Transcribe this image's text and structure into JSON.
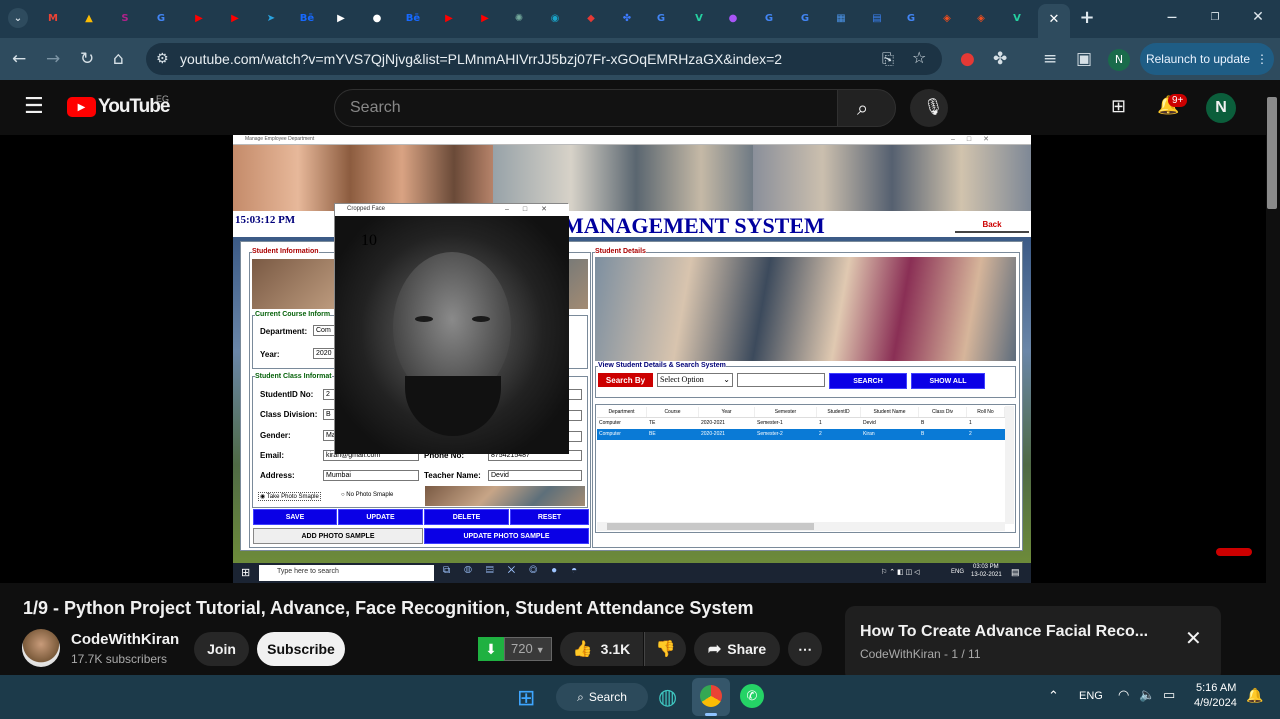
{
  "browser": {
    "tabs": [
      {
        "icon": "gmail-icon",
        "glyph": "M",
        "color": "#ea4335"
      },
      {
        "icon": "drive-icon",
        "glyph": "▲",
        "color": "#fbbc04"
      },
      {
        "icon": "s-icon",
        "glyph": "S",
        "color": "#b0218a"
      },
      {
        "icon": "google-icon",
        "glyph": "G",
        "color": "#4285f4"
      },
      {
        "icon": "youtube-icon",
        "glyph": "▶",
        "color": "#ff0000"
      },
      {
        "icon": "youtube-icon",
        "glyph": "▶",
        "color": "#ff0000"
      },
      {
        "icon": "telegram-icon",
        "glyph": "➤",
        "color": "#2aa3e0"
      },
      {
        "icon": "behance-icon",
        "glyph": "Bē",
        "color": "#1769ff"
      },
      {
        "icon": "doc-icon",
        "glyph": "▶",
        "color": "#ffffff"
      },
      {
        "icon": "github-icon",
        "glyph": "●",
        "color": "#ffffff"
      },
      {
        "icon": "behance-icon",
        "glyph": "Bē",
        "color": "#1769ff"
      },
      {
        "icon": "youtube-icon",
        "glyph": "▶",
        "color": "#ff0000"
      },
      {
        "icon": "youtube-icon",
        "glyph": "▶",
        "color": "#ff0000"
      },
      {
        "icon": "chatgpt-icon",
        "glyph": "✺",
        "color": "#74aa9c"
      },
      {
        "icon": "lens-icon",
        "glyph": "◉",
        "color": "#1aa3c8"
      },
      {
        "icon": "app-icon",
        "glyph": "◆",
        "color": "#e53935"
      },
      {
        "icon": "puzzle-icon",
        "glyph": "✤",
        "color": "#3d7bff"
      },
      {
        "icon": "google-icon",
        "glyph": "G",
        "color": "#4285f4"
      },
      {
        "icon": "v-icon",
        "glyph": "V",
        "color": "#25d0a0"
      },
      {
        "icon": "drop-icon",
        "glyph": "●",
        "color": "#a855f7"
      },
      {
        "icon": "google-icon",
        "glyph": "G",
        "color": "#4285f4"
      },
      {
        "icon": "google-icon",
        "glyph": "G",
        "color": "#4285f4"
      },
      {
        "icon": "grid-icon",
        "glyph": "▦",
        "color": "#4a90e2"
      },
      {
        "icon": "form-icon",
        "glyph": "▤",
        "color": "#3b82f6"
      },
      {
        "icon": "google-icon",
        "glyph": "G",
        "color": "#4285f4"
      },
      {
        "icon": "figma-icon",
        "glyph": "◈",
        "color": "#f24e1e"
      },
      {
        "icon": "figma-icon",
        "glyph": "◈",
        "color": "#f24e1e"
      },
      {
        "icon": "v-icon",
        "glyph": "V",
        "color": "#25d0a0"
      }
    ],
    "url": "youtube.com/watch?v=mYVS7QjNjvg&list=PLMnmAHIVrrJJ5bzj07Fr-xGOqEMRHzaGX&index=2",
    "relaunch_label": "Relaunch to update",
    "profile_initial": "N"
  },
  "youtube": {
    "logo_text": "YouTube",
    "country": "EG",
    "search_placeholder": "Search",
    "notif_count": "9+",
    "avatar": "N",
    "video_title": "1/9 - Python Project Tutorial, Advance, Face Recognition, Student Attendance System",
    "channel": "CodeWithKiran",
    "subscribers": "17.7K subscribers",
    "join_label": "Join",
    "subscribe_label": "Subscribe",
    "quality": "720",
    "likes": "3.1K",
    "share_label": "Share",
    "up_next_title": "How To Create Advance Facial Reco...",
    "up_next_sub": "CodeWithKiran - 1 / 11"
  },
  "app": {
    "window_title": "Manage Employee Department",
    "clock": "15:03:12 PM",
    "heading": "MANAGEMENT SYSTEM",
    "back_label": "Back",
    "student_info_title": "Student Information",
    "course_title": "Current Course Inform",
    "department_label": "Department:",
    "department_value": "Com",
    "year_label": "Year:",
    "year_value": "2020",
    "class_title": "Student Class Informat",
    "studentid_label": "StudentID No:",
    "studentid_value": "2",
    "classdiv_label": "Class Division:",
    "classdiv_value": "B",
    "gender_label": "Gender:",
    "gender_value": "Ma",
    "email_label": "Email:",
    "email_value": "kiran@gmail.com",
    "phone_label": "Phone No:",
    "phone_value": "8754215487",
    "address_label": "Address:",
    "address_value": "Mumbai",
    "teacher_label": "Teacher Name:",
    "teacher_value": "Devid",
    "radio1": "Take Photo Smaple",
    "radio2": "No Photo Smaple",
    "buttons": [
      "SAVE",
      "UPDATE",
      "DELETE",
      "RESET"
    ],
    "add_photo": "ADD PHOTO SAMPLE",
    "update_photo": "UPDATE PHOTO SAMPLE",
    "student_details_title": "Student Details",
    "search_system_title": "View Student Details & Search System",
    "search_by": "Search By",
    "select_option": "Select Option",
    "search_btn": "SEARCH",
    "show_all_btn": "SHOW ALL",
    "table_headers": [
      "Department",
      "Course",
      "Year",
      "Semester",
      "StudentID",
      "Student Name",
      "Class Div",
      "Roll No"
    ],
    "table_rows": [
      [
        "Computer",
        "TE",
        "2020-2021",
        "Semester-1",
        "1",
        "Devid",
        "B",
        "1"
      ],
      [
        "Computer",
        "BE",
        "2020-2021",
        "Semester-2",
        "2",
        "Kiran",
        "B",
        "2"
      ]
    ],
    "cropped_title": "Cropped Face",
    "cropped_counter": "10",
    "taskbar_search": "Type here to search",
    "taskbar_time": "03:03 PM",
    "taskbar_date": "13-02-2021",
    "taskbar_lang": "ENG"
  },
  "windows": {
    "search_label": "Search",
    "lang": "ENG",
    "time": "5:16 AM",
    "date": "4/9/2024"
  }
}
